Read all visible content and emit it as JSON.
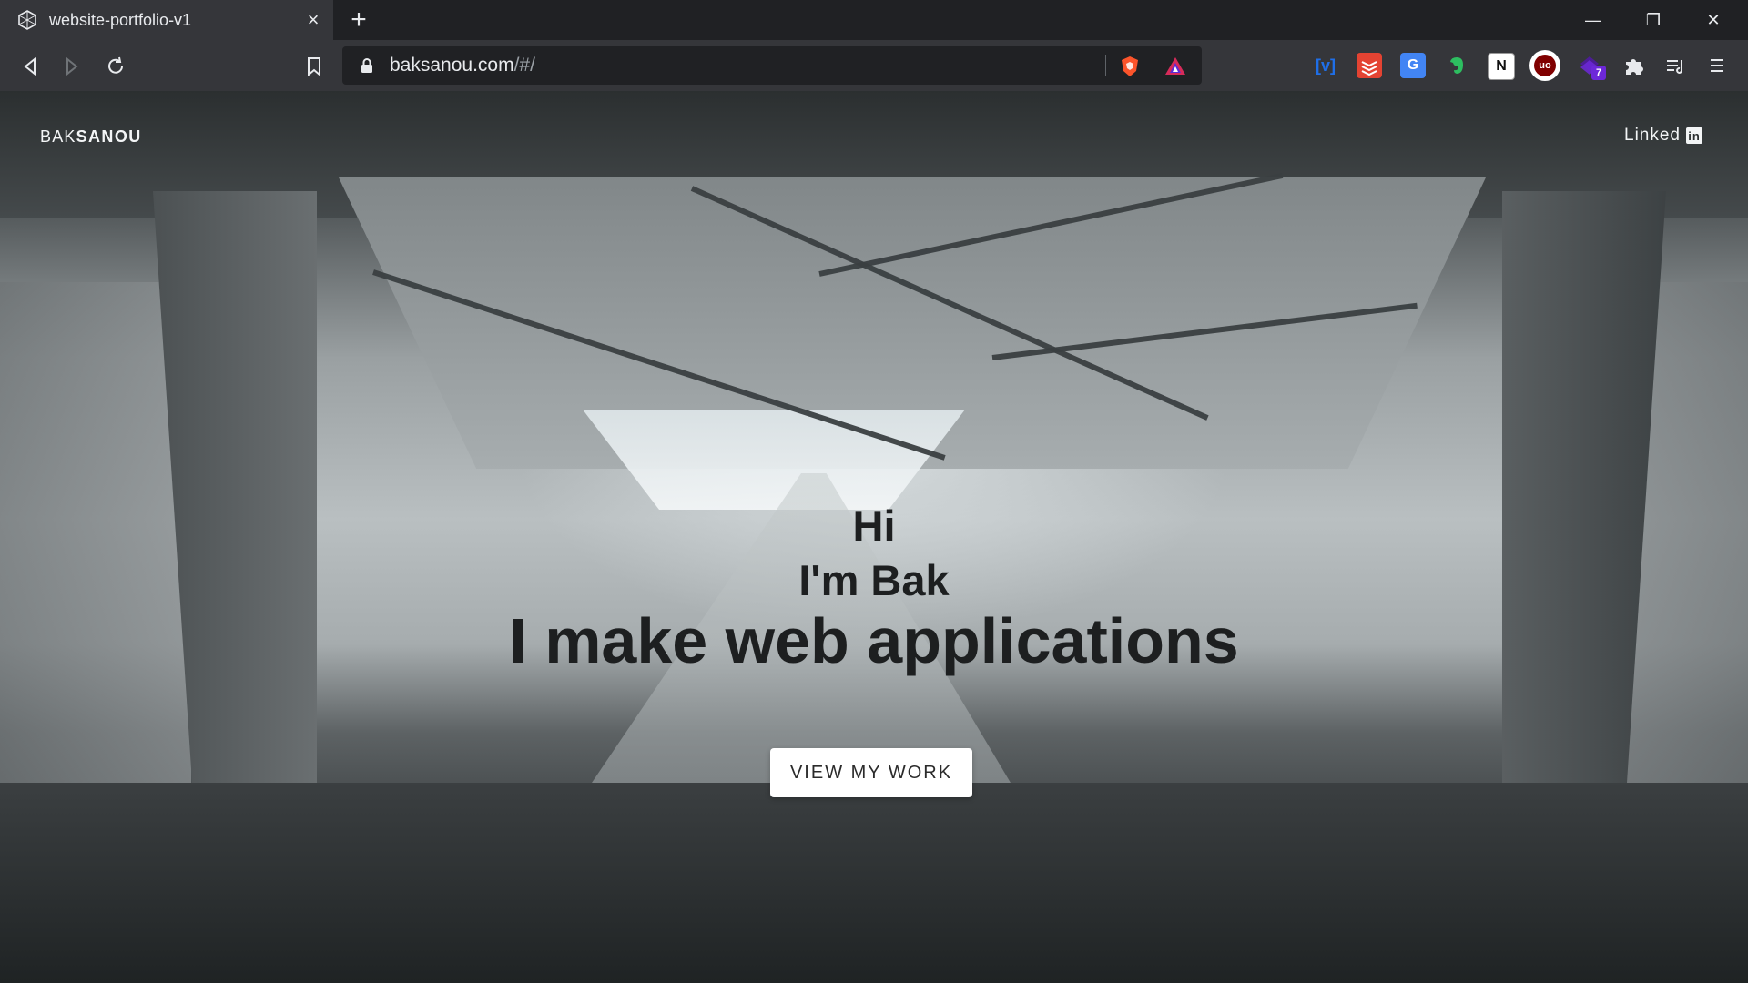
{
  "browser": {
    "tab_title": "website-portfolio-v1",
    "tab_close": "×",
    "new_tab": "+",
    "url_host": "baksanou.com",
    "url_path": "/#/",
    "controls": {
      "minimize": "—",
      "restore": "❐",
      "close": "✕"
    },
    "extensions": [
      {
        "name": "vm-icon",
        "label": "[v]",
        "color": "#1f6fe8"
      },
      {
        "name": "todoist-icon",
        "label": "",
        "color": "#e44332"
      },
      {
        "name": "translate-icon",
        "label": "G",
        "color": "#4285f4"
      },
      {
        "name": "evernote-icon",
        "label": "",
        "color": "#2dbe60"
      },
      {
        "name": "notion-icon",
        "label": "N",
        "color": "#ffffff"
      },
      {
        "name": "ublock-icon",
        "label": "uo",
        "color": "#800000"
      },
      {
        "name": "extension-badge-icon",
        "label": "7",
        "color": "#6d28d9"
      }
    ]
  },
  "site": {
    "brand_light": "BAK",
    "brand_strong": "SANOU",
    "linkedin_label": "Linked",
    "linkedin_badge": "in",
    "hero": {
      "hi": "Hi",
      "name": "I'm Bak",
      "tagline": "I make web applications"
    },
    "cta_label": "VIEW MY WORK"
  }
}
